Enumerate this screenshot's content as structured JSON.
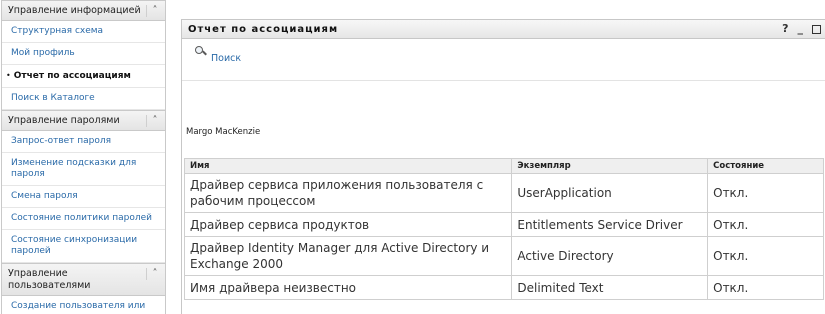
{
  "sidebar": {
    "sections": [
      {
        "title": "Управление информацией",
        "items": [
          {
            "label": "Структурная схема",
            "active": false
          },
          {
            "label": "Мой профиль",
            "active": false
          },
          {
            "label": "Отчет по ассоциациям",
            "active": true
          },
          {
            "label": "Поиск в Каталоге",
            "active": false
          }
        ]
      },
      {
        "title": "Управление паролями",
        "items": [
          {
            "label": "Запрос-ответ пароля"
          },
          {
            "label": "Изменение подсказки для пароля"
          },
          {
            "label": "Смена пароля"
          },
          {
            "label": "Состояние политики паролей"
          },
          {
            "label": "Состояние синхронизации паролей"
          }
        ]
      },
      {
        "title": "Управление пользователями",
        "items": [
          {
            "label": "Создание пользователя или группы"
          }
        ]
      }
    ],
    "collapse_icon": "chevron-up-double-icon"
  },
  "portlet": {
    "title": "Отчет по ассоциациям",
    "controls": {
      "help": "?",
      "minimize": "_"
    },
    "search_label": "Поиск",
    "user_name": "Margo MacKenzie",
    "table": {
      "headers": [
        "Имя",
        "Экземпляр",
        "Состояние"
      ],
      "rows": [
        [
          "Драйвер сервиса приложения пользователя с рабочим процессом",
          "UserApplication",
          "Откл."
        ],
        [
          "Драйвер сервиса продуктов",
          "Entitlements Service Driver",
          "Откл."
        ],
        [
          "Драйвер Identity Manager для Active Directory и Exchange 2000",
          "Active Directory",
          "Откл."
        ],
        [
          "Имя драйвера неизвестно",
          "Delimited Text",
          "Откл."
        ]
      ]
    }
  }
}
